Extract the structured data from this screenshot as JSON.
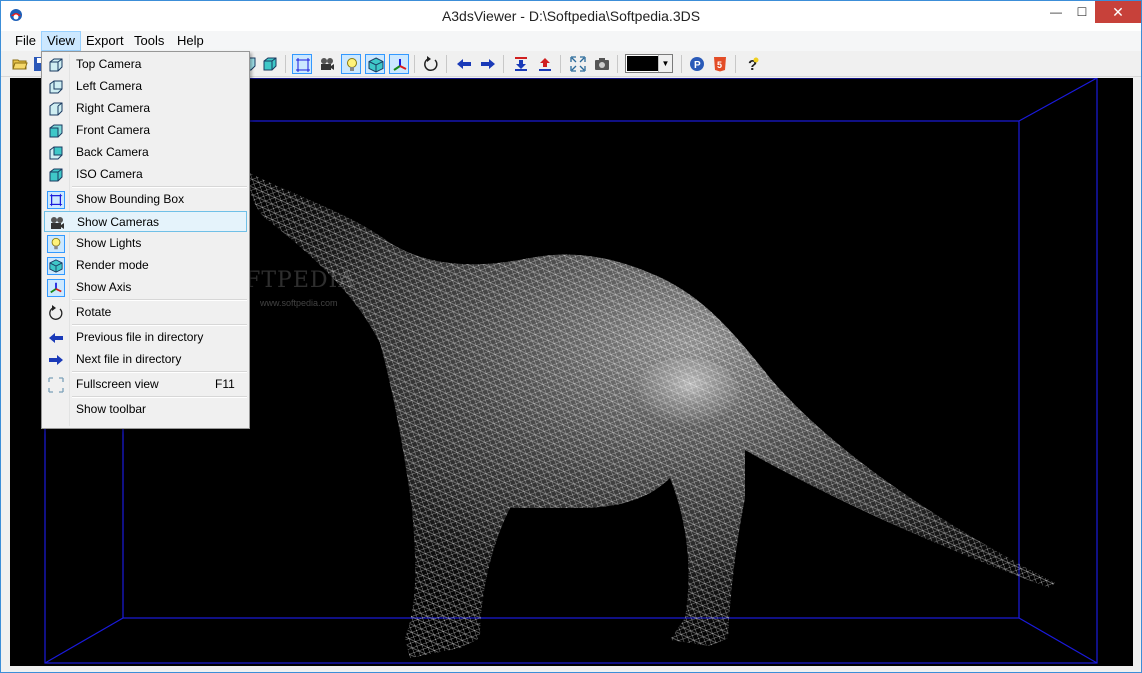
{
  "window": {
    "title": "A3dsViewer - D:\\Softpedia\\Softpedia.3DS",
    "controls": {
      "minimize": "—",
      "maximize": "☐",
      "close": "✕"
    }
  },
  "menubar": {
    "items": [
      {
        "label": "File"
      },
      {
        "label": "View"
      },
      {
        "label": "Export"
      },
      {
        "label": "Tools"
      },
      {
        "label": "Help"
      }
    ]
  },
  "toolbar": {
    "background_color": "#000000",
    "icons": [
      "open-icon",
      "save-icon",
      "top-camera-icon",
      "iso-camera-icon",
      "bounding-box-icon",
      "cameras-icon",
      "lights-icon",
      "render-mode-icon",
      "axis-icon",
      "rotate-icon",
      "previous-file-icon",
      "next-file-icon",
      "import-icon",
      "export-icon",
      "fullscreen-icon",
      "screenshot-icon",
      "color-combo",
      "paypal-icon",
      "html5-icon",
      "help-icon"
    ]
  },
  "watermark": {
    "text": "SOFTPEDIA",
    "url": "www.softpedia.com"
  },
  "view_menu": {
    "items": [
      {
        "label": "Top Camera",
        "icon": "top-camera-icon",
        "checked": false
      },
      {
        "label": "Left Camera",
        "icon": "left-camera-icon",
        "checked": false
      },
      {
        "label": "Right Camera",
        "icon": "right-camera-icon",
        "checked": false
      },
      {
        "label": "Front Camera",
        "icon": "front-camera-icon",
        "checked": false
      },
      {
        "label": "Back Camera",
        "icon": "back-camera-icon",
        "checked": false
      },
      {
        "label": "ISO Camera",
        "icon": "iso-camera-icon",
        "checked": false
      },
      {
        "label": "Show Bounding Box",
        "icon": "bounding-box-icon",
        "checked": true
      },
      {
        "label": "Show Cameras",
        "icon": "cameras-icon",
        "checked": false,
        "highlighted": true
      },
      {
        "label": "Show Lights",
        "icon": "lights-icon",
        "checked": true
      },
      {
        "label": "Render mode",
        "icon": "render-mode-icon",
        "checked": true
      },
      {
        "label": "Show Axis",
        "icon": "axis-icon",
        "checked": true
      },
      {
        "label": "Rotate",
        "icon": "rotate-icon",
        "checked": false
      },
      {
        "label": "Previous file in directory",
        "icon": "previous-file-icon",
        "checked": false
      },
      {
        "label": "Next file in directory",
        "icon": "next-file-icon",
        "checked": false
      },
      {
        "label": "Fullscreen view",
        "icon": "fullscreen-icon",
        "shortcut": "F11",
        "checked": false
      },
      {
        "label": "Show toolbar",
        "icon": "",
        "checked": false
      }
    ]
  },
  "colors": {
    "bounding_box": "#1a1adc",
    "menu_highlight": "#e5f3fb",
    "checked_bg": "#cce8ff",
    "close_button": "#c7413a"
  }
}
